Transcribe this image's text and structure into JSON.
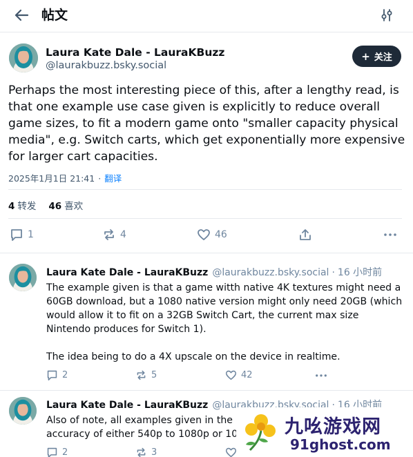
{
  "header": {
    "title": "帖文"
  },
  "post": {
    "author_name": "Laura Kate Dale - LauraKBuzz",
    "author_handle": "@laurakbuzz.bsky.social",
    "follow_label": "关注",
    "text": "Perhaps the most interesting piece of this, after a lengthy read, is that one example use case given is explicitly to reduce overall game sizes, to fit a modern game onto \"smaller capacity physical media\", e.g. Switch carts, which get exponentially more expensive for larger cart capacities.",
    "timestamp": "2025年1月1日 21:41",
    "separator": "·",
    "translate_label": "翻译",
    "reposts_count": "4",
    "reposts_label": "转发",
    "likes_count": "46",
    "likes_label": "喜欢",
    "actions": {
      "reply_count": "1",
      "repost_count": "4",
      "like_count": "46"
    }
  },
  "replies": [
    {
      "author_name": "Laura Kate Dale - LauraKBuzz",
      "author_handle": "@laurakbuzz.bsky.social",
      "separator": "·",
      "time": "16 小时前",
      "text": "The example given is that a game witth native 4K textures might need a 60GB download, but a 1080 native version might only need 20GB (which would allow it to fit on a 32GB Switch Cart, the current max size Nintendo produces for Switch 1).\n\nThe idea being to do a 4X upscale on the device in realtime.",
      "reply_count": "2",
      "repost_count": "5",
      "like_count": "42"
    },
    {
      "author_name": "Laura Kate Dale - LauraKBuzz",
      "author_handle": "@laurakbuzz.bsky.social",
      "separator": "·",
      "time": "16 小时前",
      "text": "Also of note, all examples given in the\naccuracy of either 540p to 1080p or 10",
      "reply_count": "2",
      "repost_count": "3",
      "like_count": ""
    }
  ],
  "watermark": {
    "title": "九吆游戏网",
    "url": "91ghost.com"
  },
  "colors": {
    "text_primary": "#0b0f14",
    "text_secondary": "#42576c",
    "icon_muted": "#6f869f",
    "link": "#1083fe",
    "follow_button": "#1e2a38",
    "divider": "#e6e9ed",
    "watermark": "#2d2370"
  }
}
